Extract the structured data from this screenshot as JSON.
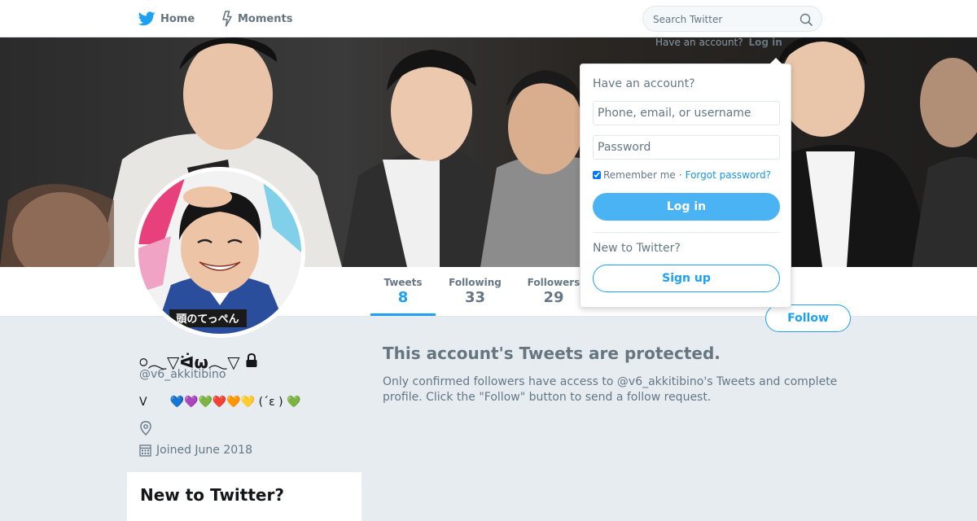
{
  "nav": {
    "home_label": "Home",
    "moments_label": "Moments",
    "search_placeholder": "Search Twitter",
    "have_account_text": "Have an account?",
    "login_link": "Log in"
  },
  "profile": {
    "name": "𓏸𓂃▽ᐛω𓂃▽",
    "handle": "@v6_akkitibino",
    "bio": "V　　💙💜💚❤️🧡💛 (´ε ) 💚",
    "joined": "Joined June 2018",
    "stats": [
      {
        "label": "Tweets",
        "value": "8"
      },
      {
        "label": "Following",
        "value": "33"
      },
      {
        "label": "Followers",
        "value": "29"
      }
    ],
    "follow_label": "Follow",
    "avatar_caption": "頭のてっぺん"
  },
  "protected": {
    "title": "This account's Tweets are protected.",
    "text": "Only confirmed followers have access to @v6_akkitibino's Tweets and complete profile. Click the \"Follow\" button to send a follow request."
  },
  "sidebar": {
    "new_to_twitter": "New to Twitter?"
  },
  "login_dropdown": {
    "title": "Have an account?",
    "username_placeholder": "Phone, email, or username",
    "password_placeholder": "Password",
    "remember_label": "Remember me",
    "separator": "·",
    "forgot_label": "Forgot password?",
    "login_button": "Log in",
    "new_to_twitter": "New to Twitter?",
    "signup_button": "Sign up"
  },
  "colors": {
    "accent": "#1da1f2",
    "login_button": "#4ab3f4",
    "page_background": "#e6ecf0"
  }
}
